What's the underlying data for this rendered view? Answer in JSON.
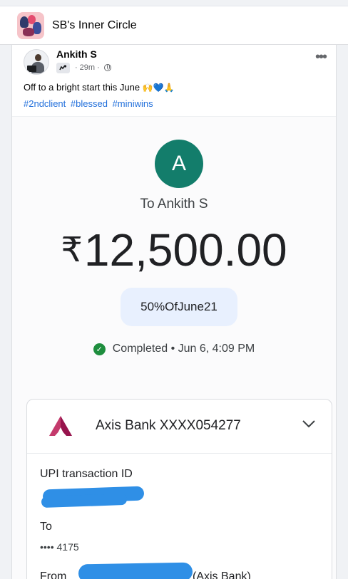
{
  "group": {
    "name": "SB's Inner Circle"
  },
  "post": {
    "author": "Ankith S",
    "time": "29m",
    "text": "Off to a bright start this June",
    "emojis": "🙌💙🙏",
    "hashtags": [
      "#2ndclient",
      "#blessed",
      "#miniwins"
    ],
    "more_label": "•••"
  },
  "payment": {
    "avatar_letter": "A",
    "recipient": "To Ankith S",
    "currency": "₹",
    "amount": "12,500.00",
    "note": "50%OfJune21",
    "status": "Completed • Jun 6, 4:09 PM",
    "status_check": "✓",
    "bank_name": "Axis Bank XXXX054277",
    "upi_label": "UPI transaction ID",
    "to_label": "To",
    "to_value": "•••• 4175",
    "from_label": "From",
    "from_value": "(Axis Bank)"
  },
  "colors": {
    "accent": "#216fdb",
    "avatar_green": "#137d6b",
    "success": "#1e8e3e",
    "redaction": "#2f8fe6",
    "axis_red": "#97144d"
  }
}
